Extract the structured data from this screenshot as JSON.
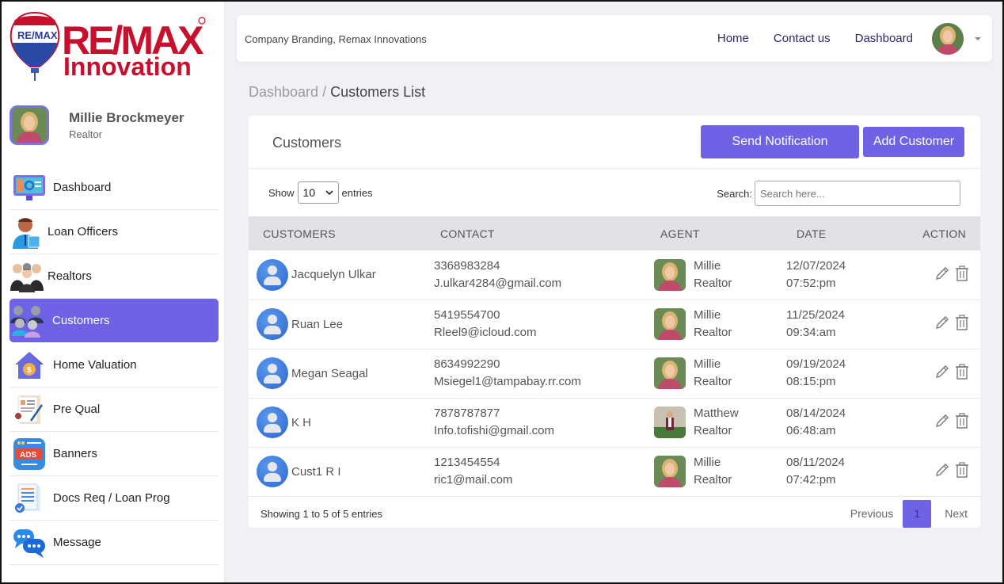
{
  "brand": {
    "logo_word": "RE/MAX",
    "logo_sub": "Innovation",
    "colors": {
      "red": "#c8102e",
      "blue": "#2a3d9a",
      "accent": "#6e62e5"
    }
  },
  "profile": {
    "name": "Millie Brockmeyer",
    "role": "Realtor"
  },
  "sidebar": {
    "items": [
      {
        "label": "Dashboard",
        "icon": "monitor-dashboard-icon",
        "active": false
      },
      {
        "label": "Loan Officers",
        "icon": "loan-officer-icon",
        "active": false
      },
      {
        "label": "Realtors",
        "icon": "realtors-group-icon",
        "active": false
      },
      {
        "label": "Customers",
        "icon": "customers-group-icon",
        "active": true
      },
      {
        "label": "Home Valuation",
        "icon": "house-dollar-icon",
        "active": false
      },
      {
        "label": "Pre Qual",
        "icon": "document-sign-icon",
        "active": false
      },
      {
        "label": "Banners",
        "icon": "ads-banner-icon",
        "active": false
      },
      {
        "label": "Docs Req / Loan Prog",
        "icon": "checklist-docs-icon",
        "active": false
      },
      {
        "label": "Message",
        "icon": "chat-bubbles-icon",
        "active": false
      }
    ]
  },
  "topbar": {
    "title": "Company Branding, Remax Innovations",
    "links": [
      "Home",
      "Contact us",
      "Dashboard"
    ]
  },
  "breadcrumb": {
    "parent": "Dashboard",
    "separator": "/",
    "current": "Customers List"
  },
  "card": {
    "title": "Customers",
    "send_notification_label": "Send Notification",
    "add_customer_label": "Add Customer",
    "show_label": "Show",
    "entries_label": "entries",
    "page_size": "10",
    "search_label": "Search:",
    "search_placeholder": "Search here...",
    "search_value": ""
  },
  "table": {
    "columns": [
      "CUSTOMERS",
      "CONTACT",
      "AGENT",
      "DATE",
      "ACTION"
    ],
    "rows": [
      {
        "name": "Jacquelyn Ulkar",
        "phone": "3368983284",
        "email": "J.ulkar4284@gmail.com",
        "agent": "Millie",
        "agent_role": "Realtor",
        "agent_photo": "millie",
        "date": "12/07/2024",
        "time": "07:52:pm"
      },
      {
        "name": "Ruan Lee",
        "phone": "5419554700",
        "email": "Rleel9@icloud.com",
        "agent": "Millie",
        "agent_role": "Realtor",
        "agent_photo": "millie",
        "date": "11/25/2024",
        "time": "09:34:am"
      },
      {
        "name": "Megan Seagal",
        "phone": "8634992290",
        "email": "Msiegel1@tampabay.rr.com",
        "agent": "Millie",
        "agent_role": "Realtor",
        "agent_photo": "millie",
        "date": "09/19/2024",
        "time": "08:15:pm"
      },
      {
        "name": "K H",
        "phone": "7878787877",
        "email": "Info.tofishi@gmail.com",
        "agent": "Matthew",
        "agent_role": "Realtor",
        "agent_photo": "matthew",
        "date": "08/14/2024",
        "time": "06:48:am"
      },
      {
        "name": "Cust1 R I",
        "phone": "1213454554",
        "email": "ric1@mail.com",
        "agent": "Millie",
        "agent_role": "Realtor",
        "agent_photo": "millie",
        "date": "08/11/2024",
        "time": "07:42:pm"
      }
    ]
  },
  "footer": {
    "showing": "Showing 1 to 5 of 5 entries",
    "previous": "Previous",
    "current_page": "1",
    "next": "Next"
  }
}
